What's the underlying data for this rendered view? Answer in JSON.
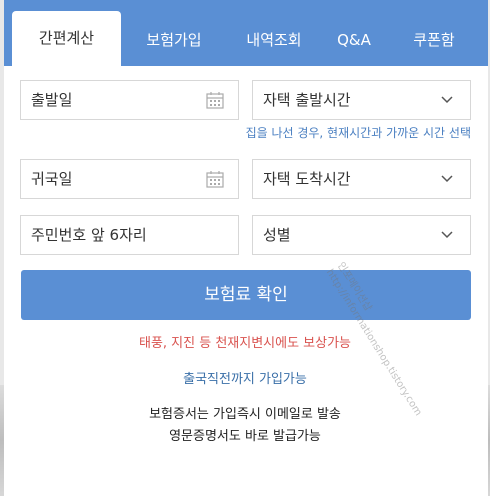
{
  "tabs": [
    {
      "label": "간편계산",
      "active": true
    },
    {
      "label": "보험가입",
      "active": false
    },
    {
      "label": "내역조회",
      "active": false
    },
    {
      "label": "Q&A",
      "active": false
    },
    {
      "label": "쿠폰함",
      "active": false
    }
  ],
  "form": {
    "departure_date_placeholder": "출발일",
    "departure_time_select": "자택 출발시간",
    "departure_hint": "집을 나선 경우, 현재시간과 가까운 시간 선택",
    "return_date_placeholder": "귀국일",
    "arrival_time_select": "자택 도착시간",
    "id_number_placeholder": "주민번호 앞 6자리",
    "gender_select": "성별",
    "submit_label": "보험료 확인"
  },
  "notes": {
    "disaster": "태풍, 지진 등 천재지변시에도 보상가능",
    "signup": "출국직전까지 가입가능",
    "certificate_line1": "보험증서는 가입즉시 이메일로 발송",
    "certificate_line2": "영문증명서도 바로 발급가능"
  },
  "watermark": {
    "line1": "인포메이션샵",
    "line2": "http://informationshop.tistory.com"
  },
  "colors": {
    "accent": "#5a8fd4",
    "hint": "#4a7fc1",
    "warning": "#d9534f",
    "info": "#3a6fa8"
  },
  "icons": {
    "calendar": "calendar-icon",
    "dropdown": "chevron-down-icon"
  }
}
